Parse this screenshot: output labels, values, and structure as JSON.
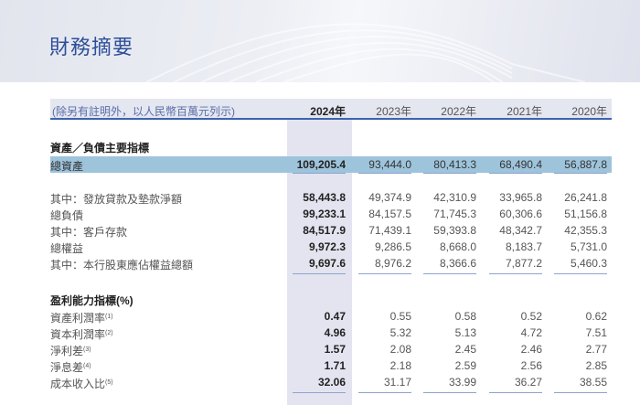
{
  "title": "財務摘要",
  "header": {
    "note": "(除另有註明外，以人民幣百萬元列示)",
    "years": [
      "2024年",
      "2023年",
      "2022年",
      "2021年",
      "2020年"
    ]
  },
  "sections": [
    {
      "heading": "資產／負債主要指標",
      "rows": [
        {
          "label": "總資產",
          "values": [
            "109,205.4",
            "93,444.0",
            "80,413.3",
            "68,490.4",
            "56,887.8"
          ],
          "highlight": true
        },
        {
          "label": "其中：發放貸款及墊款淨額",
          "values": [
            "58,443.8",
            "49,374.9",
            "42,310.9",
            "33,965.8",
            "26,241.8"
          ]
        },
        {
          "label": "總負債",
          "values": [
            "99,233.1",
            "84,157.5",
            "71,745.3",
            "60,306.6",
            "51,156.8"
          ]
        },
        {
          "label": "其中：客戶存款",
          "values": [
            "84,517.9",
            "71,439.1",
            "59,393.8",
            "48,342.7",
            "42,355.3"
          ]
        },
        {
          "label": "總權益",
          "values": [
            "9,972.3",
            "9,286.5",
            "8,668.0",
            "8,183.7",
            "5,731.0"
          ]
        },
        {
          "label": "其中：本行股東應佔權益總額",
          "values": [
            "9,697.6",
            "8,976.2",
            "8,366.6",
            "7,877.2",
            "5,460.3"
          ]
        }
      ]
    },
    {
      "heading": "盈利能力指標(%)",
      "rows": [
        {
          "label": "資產利潤率",
          "note": "(1)",
          "values": [
            "0.47",
            "0.55",
            "0.58",
            "0.52",
            "0.62"
          ]
        },
        {
          "label": "資本利潤率",
          "note": "(2)",
          "values": [
            "4.96",
            "5.32",
            "5.13",
            "4.72",
            "7.51"
          ]
        },
        {
          "label": "淨利差",
          "note": "(3)",
          "values": [
            "1.57",
            "2.08",
            "2.45",
            "2.46",
            "2.77"
          ]
        },
        {
          "label": "淨息差",
          "note": "(4)",
          "values": [
            "1.71",
            "2.18",
            "2.59",
            "2.56",
            "2.85"
          ]
        },
        {
          "label": "成本收入比",
          "note": "(5)",
          "values": [
            "32.06",
            "31.17",
            "33.99",
            "36.27",
            "38.55"
          ]
        }
      ]
    }
  ]
}
